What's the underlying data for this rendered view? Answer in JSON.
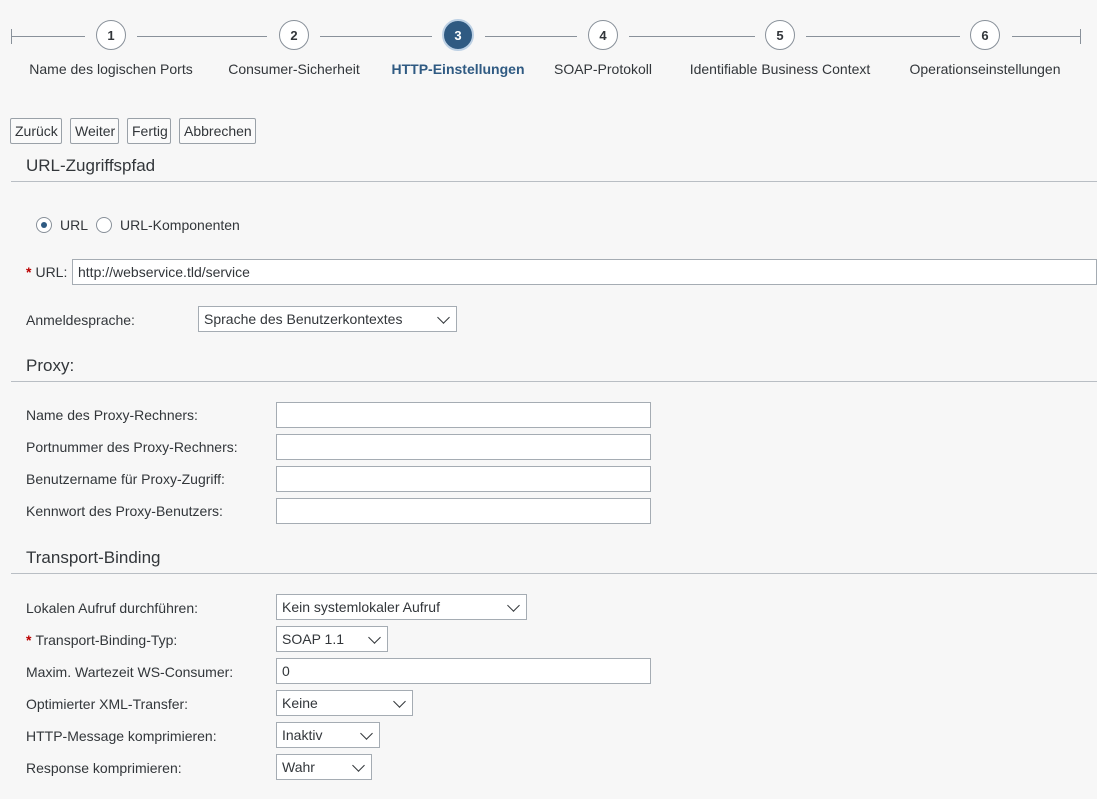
{
  "roadmap": {
    "steps": [
      {
        "number": "1",
        "label": "Name des logischen Ports"
      },
      {
        "number": "2",
        "label": "Consumer-Sicherheit"
      },
      {
        "number": "3",
        "label": "HTTP-Einstellungen"
      },
      {
        "number": "4",
        "label": "SOAP-Protokoll"
      },
      {
        "number": "5",
        "label": "Identifiable Business Context"
      },
      {
        "number": "6",
        "label": "Operationseinstellungen"
      }
    ],
    "active_step": "3",
    "accent_color": "#2f5a82"
  },
  "toolbar": {
    "back_label": "Zurück",
    "next_label": "Weiter",
    "finish_label": "Fertig",
    "cancel_label": "Abbrechen"
  },
  "url_section": {
    "title": "URL-Zugriffspfad",
    "radio_url_label": "URL",
    "radio_components_label": "URL-Komponenten",
    "selected_radio": "URL",
    "url_label": "URL:",
    "url_value": "http://webservice.tld/service",
    "required_marker": "*",
    "logon_language_label": "Anmeldesprache:",
    "logon_language_value": "Sprache des Benutzerkontextes"
  },
  "proxy_section": {
    "title": "Proxy:",
    "host_label": "Name des Proxy-Rechners:",
    "host_value": "",
    "port_label": "Portnummer des Proxy-Rechners:",
    "port_value": "",
    "user_label": "Benutzername für Proxy-Zugriff:",
    "user_value": "",
    "password_label": "Kennwort des Proxy-Benutzers:",
    "password_value": ""
  },
  "transport_section": {
    "title": "Transport-Binding",
    "local_call_label": "Lokalen Aufruf durchführen:",
    "local_call_value": "Kein systemlokaler Aufruf",
    "binding_type_label": "Transport-Binding-Typ:",
    "binding_type_value": "SOAP 1.1",
    "max_wait_label": "Maxim. Wartezeit WS-Consumer:",
    "max_wait_value": "0",
    "xml_transfer_label": "Optimierter XML-Transfer:",
    "xml_transfer_value": "Keine",
    "http_compress_label": "HTTP-Message komprimieren:",
    "http_compress_value": "Inaktiv",
    "response_compress_label": "Response komprimieren:",
    "response_compress_value": "Wahr"
  }
}
